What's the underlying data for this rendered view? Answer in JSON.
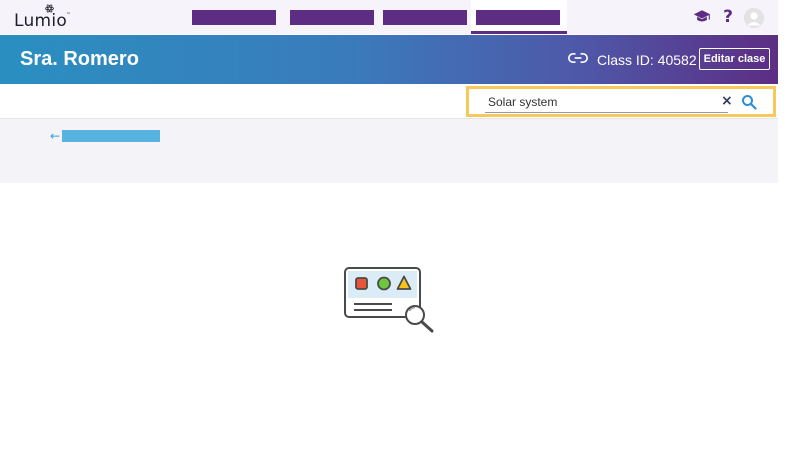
{
  "app": {
    "logo_text": "Lumio",
    "brand_colors": {
      "purple": "#5c2d83",
      "blue": "#2a8fc0",
      "search_highlight": "#f7c85a"
    }
  },
  "top_nav": {
    "tabs": [
      {
        "id": "tab-1",
        "label": ""
      },
      {
        "id": "tab-2",
        "label": ""
      },
      {
        "id": "tab-3",
        "label": ""
      },
      {
        "id": "tab-4",
        "label": "",
        "active": true
      }
    ],
    "icons": [
      "graduation-cap-icon",
      "help-icon",
      "user-avatar-icon"
    ]
  },
  "banner": {
    "teacher_name": "Sra. Romero",
    "class_id_text": "Class ID: 40582",
    "edit_button_label": "Editar clase"
  },
  "search": {
    "value": "Solar system",
    "clear_icon": "close-icon",
    "search_icon": "search-icon"
  },
  "results": {
    "back_link_label": "",
    "empty_state_icon": "empty-results-illustration"
  }
}
